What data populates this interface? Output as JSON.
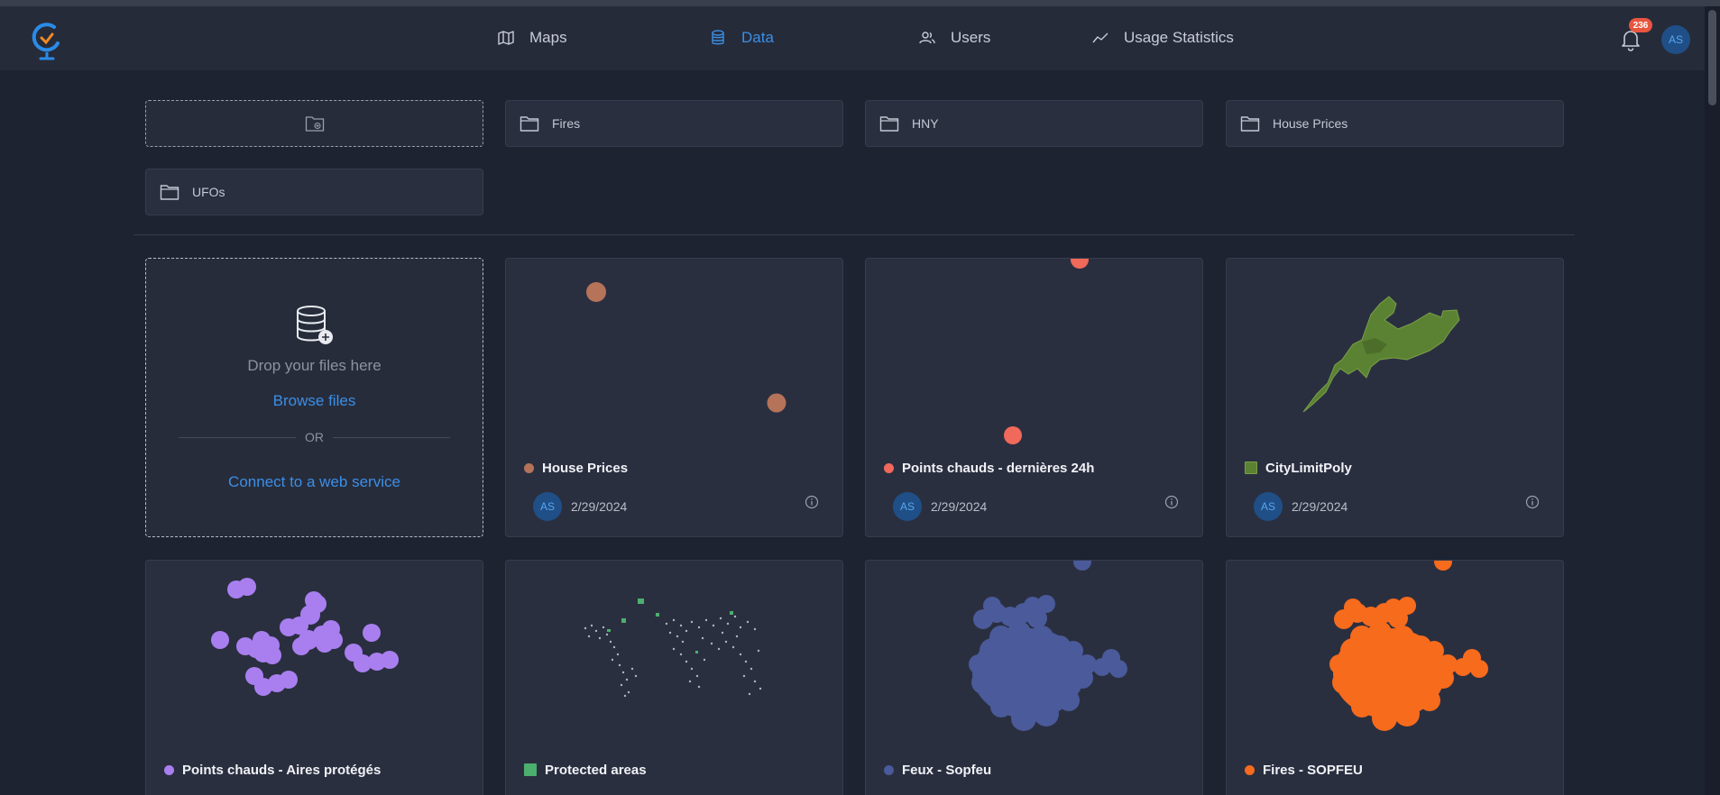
{
  "nav": {
    "items": [
      {
        "label": "Maps",
        "icon": "map-icon"
      },
      {
        "label": "Data",
        "icon": "database-icon",
        "active": true
      },
      {
        "label": "Users",
        "icon": "users-icon"
      },
      {
        "label": "Usage Statistics",
        "icon": "chart-line-icon"
      }
    ],
    "notification_count": "236",
    "user_initials": "AS"
  },
  "folders": [
    {
      "label": "Fires"
    },
    {
      "label": "HNY"
    },
    {
      "label": "House Prices"
    },
    {
      "label": "UFOs"
    }
  ],
  "upload": {
    "drop_text": "Drop your files here",
    "browse_label": "Browse files",
    "or_text": "OR",
    "connect_label": "Connect to a web service"
  },
  "datasets": [
    {
      "title": "House Prices",
      "date": "2/29/2024",
      "owner": "AS",
      "color": "#b5735a",
      "swatch": "dot"
    },
    {
      "title": "Points chauds - dernières 24h",
      "date": "2/29/2024",
      "owner": "AS",
      "color": "#f0695a",
      "swatch": "dot"
    },
    {
      "title": "CityLimitPoly",
      "date": "2/29/2024",
      "owner": "AS",
      "color": "#5a8232",
      "swatch": "square"
    },
    {
      "title": "Points chauds - Aires protégés",
      "color": "#a97ff0",
      "swatch": "dot"
    },
    {
      "title": "Protected areas",
      "color": "#4caf6e",
      "swatch": "square"
    },
    {
      "title": "Feux - Sopfeu",
      "color": "#4a5a9a",
      "swatch": "dot"
    },
    {
      "title": "Fires - SOPFEU",
      "color": "#f76b1c",
      "swatch": "dot"
    }
  ],
  "colors": {
    "accent": "#3b8fe6",
    "background": "#1e2331",
    "card": "#2a2f40"
  }
}
